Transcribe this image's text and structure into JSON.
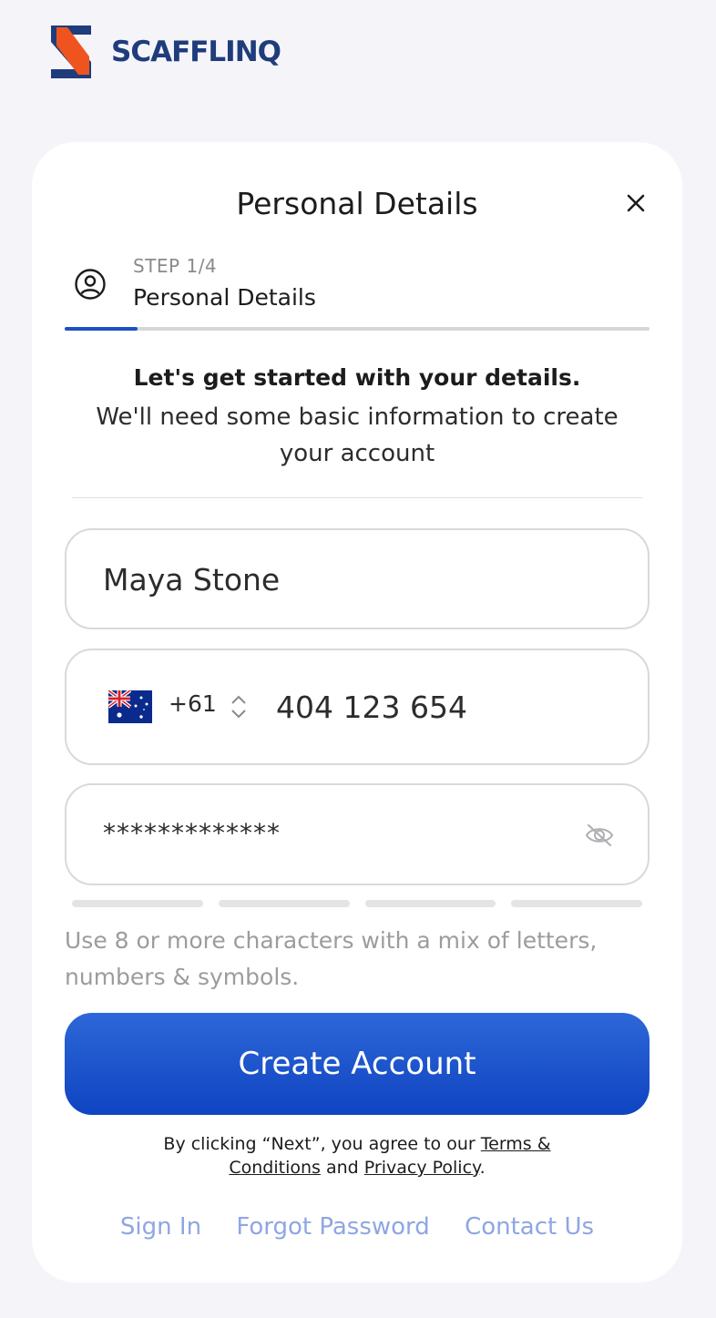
{
  "brand": {
    "name": "SCAFFLINQ",
    "colors": {
      "orange": "#f0541e",
      "navy": "#1f3c7c"
    }
  },
  "dialog": {
    "title": "Personal Details",
    "close_icon": "close-icon"
  },
  "step": {
    "label": "STEP 1/4",
    "name": "Personal Details",
    "icon": "user-circle-icon",
    "progress_fraction": 0.125
  },
  "intro": {
    "heading": "Let's get started with your details.",
    "body": "We'll need some basic information to create your account"
  },
  "form": {
    "name_value": "Maya Stone",
    "phone": {
      "country_flag_icon": "australia-flag-icon",
      "dial_code": "+61",
      "toggle_icon": "chevron-up-down-icon",
      "number_value": "404 123 654"
    },
    "password": {
      "value": "*************",
      "visibility_icon": "eye-off-icon",
      "strength_segments_filled": 0,
      "strength_segments_total": 4
    },
    "hint": "Use 8 or more characters with a mix of letters, numbers & symbols."
  },
  "actions": {
    "create_account_label": "Create Account",
    "button_color": "#1e50c4"
  },
  "legal": {
    "prefix": "By clicking “Next”, you agree to our ",
    "terms_label": "Terms & Conditions",
    "middle": " and ",
    "privacy_label": "Privacy Policy",
    "suffix": "."
  },
  "footer": {
    "sign_in": "Sign In",
    "forgot_password": "Forgot Password",
    "contact_us": "Contact Us"
  }
}
